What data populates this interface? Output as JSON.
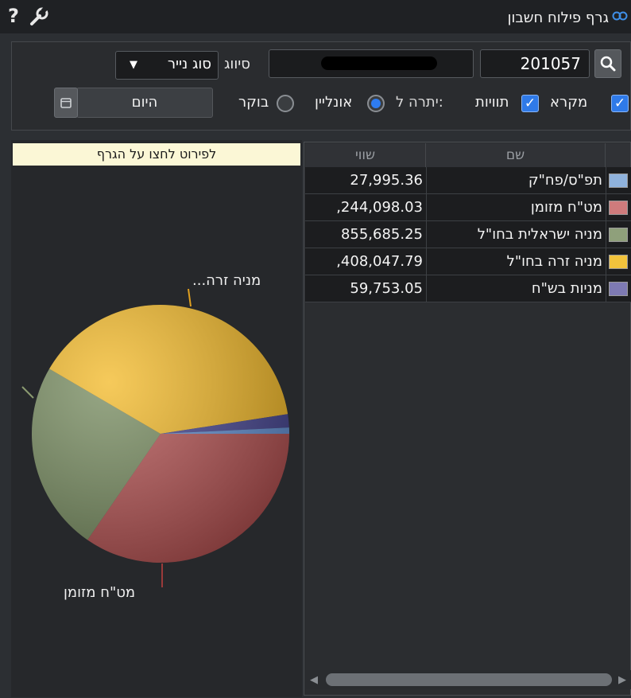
{
  "window": {
    "title": "גרף פילוח חשבון"
  },
  "icons": {
    "help": "?",
    "link": "link-icon",
    "wrench": "wrench-icon",
    "search": "search-icon",
    "calendar": "calendar-icon"
  },
  "toolbar": {
    "account_value": "201057",
    "classification_label": "סיווג",
    "classification_select": "סוג נייר",
    "legend_label": "מקרא",
    "labels_label": "תוויות",
    "balance_for_label": "יתרה ל:",
    "online_label": "אונליין",
    "morning_label": "בוקר",
    "today_button": "היום",
    "legend_checked": true,
    "labels_checked": true,
    "balance_mode": "online"
  },
  "chart": {
    "hint": "לפירוט לחצו על הגרף",
    "labels": {
      "foreign": "...מניה זרה",
      "cash": "מט\"ח מזומן"
    }
  },
  "table": {
    "columns": {
      "value": "שווי",
      "name": "שם"
    },
    "rows": [
      {
        "name": "תפ\"ס/פח\"ק",
        "value": "27,995.36",
        "color": "#8fb2dc"
      },
      {
        "name": "מט\"ח מזומן",
        "value": ",244,098.03",
        "color": "#cf7b7c"
      },
      {
        "name": "מניה ישראלית בחו\"ל",
        "value": "855,685.25",
        "color": "#8fa07b"
      },
      {
        "name": "מניה זרה בחו\"ל",
        "value": ",408,047.79",
        "color": "#f2c33c"
      },
      {
        "name": "מניות בש\"ח",
        "value": "59,753.05",
        "color": "#7e7ab3"
      }
    ]
  },
  "chart_data": {
    "type": "pie",
    "title": "",
    "slices": [
      {
        "name": "תפ\"ס/פח\"ק",
        "value": 27995.36,
        "color": "#5a8ad0"
      },
      {
        "name": "מט\"ח מזומן",
        "value": 1244098.03,
        "color": "#b04848"
      },
      {
        "name": "מניה ישראלית בחו\"ל",
        "value": 855685.25,
        "color": "#6f8556"
      },
      {
        "name": "מניה זרה בחו\"ל",
        "value": 1408047.79,
        "color": "#f2b51b"
      },
      {
        "name": "מניות בש\"ח",
        "value": 59753.05,
        "color": "#3b3a8a"
      }
    ]
  }
}
